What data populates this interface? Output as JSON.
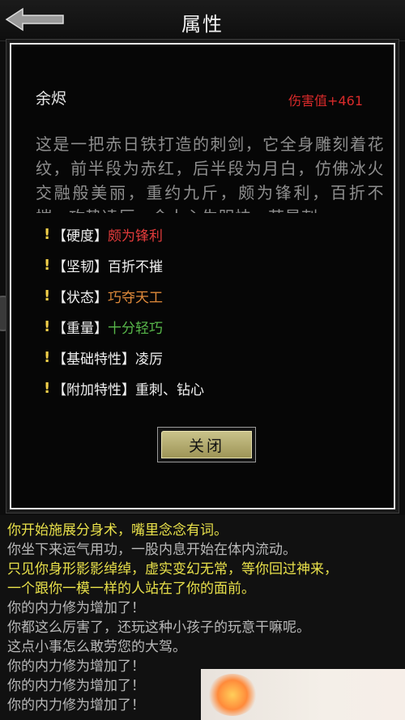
{
  "header": {
    "title": "属性"
  },
  "item": {
    "name": "余烬",
    "damage_label": "伤害值",
    "damage_value": "+461",
    "description": "这是一把赤日铁打造的刺剑，它全身雕刻着花纹，前半段为赤红，后半段为月白，仿佛冰火交融般美丽，重约九斤，颇为锋利，百折不摧，攻势凌厉，令人心生胆怯，若是刺"
  },
  "stats": [
    {
      "label": "【硬度】",
      "value": "颇为锋利",
      "color": "#e23b3b"
    },
    {
      "label": "【坚韧】",
      "value": "百折不摧",
      "color": "#f0f0f0"
    },
    {
      "label": "【状态】",
      "value": "巧夺天工",
      "color": "#e08a3a"
    },
    {
      "label": "【重量】",
      "value": "十分轻巧",
      "color": "#58b84a"
    },
    {
      "label": "【基础特性】",
      "value": "凌厉",
      "color": "#f0f0f0"
    },
    {
      "label": "【附加特性】",
      "value": "重刺、钻心",
      "color": "#f0f0f0"
    }
  ],
  "buttons": {
    "close": "关闭"
  },
  "log": [
    {
      "text": "你开始施展分身术，嘴里念念有词。",
      "color": "#e8e04a"
    },
    {
      "text": "你坐下来运气用功，一股内息开始在体内流动。",
      "color": "#b9b9b9"
    },
    {
      "text": "只见你身形影影绰绰，虚实变幻无常，等你回过神来，",
      "color": "#e8e04a"
    },
    {
      "text": "一个跟你一模一样的人站在了你的面前。",
      "color": "#e8e04a"
    },
    {
      "text": "你的内力修为增加了！",
      "color": "#b9b9b9"
    },
    {
      "text": "你都这么厉害了，还玩这种小孩子的玩意干嘛呢。",
      "color": "#b9b9b9"
    },
    {
      "text": "这点小事怎么敢劳您的大驾。",
      "color": "#b9b9b9"
    },
    {
      "text": "你的内力修为增加了！",
      "color": "#b9b9b9"
    },
    {
      "text": "你的内力修为增加了！",
      "color": "#b9b9b9"
    },
    {
      "text": "你的内力修为增加了！",
      "color": "#b9b9b9"
    }
  ],
  "icons": {
    "back": "back-arrow-icon",
    "stat_marker": "exclamation-icon"
  }
}
